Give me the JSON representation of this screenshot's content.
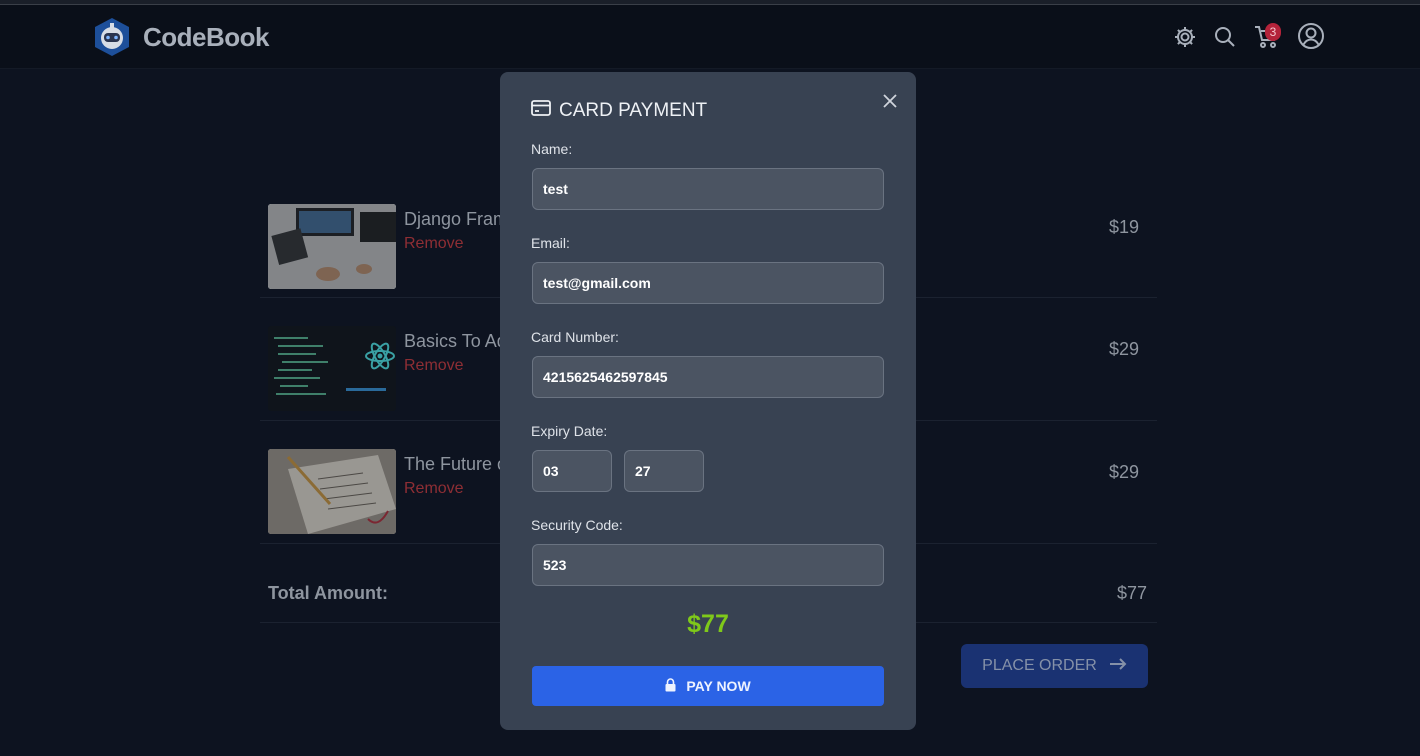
{
  "header": {
    "brand": "CodeBook",
    "cart_count": "3"
  },
  "cart": {
    "items": [
      {
        "title": "Django Fram",
        "remove_label": "Remove",
        "price": "$19"
      },
      {
        "title": "Basics To Ad",
        "remove_label": "Remove",
        "price": "$29"
      },
      {
        "title": "The Future o",
        "remove_label": "Remove",
        "price": "$29"
      }
    ],
    "total_label": "Total Amount:",
    "total_value": "$77",
    "place_order_label": "PLACE ORDER"
  },
  "modal": {
    "title": "CARD PAYMENT",
    "name_label": "Name:",
    "name_value": "test",
    "email_label": "Email:",
    "email_value": "test@gmail.com",
    "card_label": "Card Number:",
    "card_value": "4215625462597845",
    "expiry_label": "Expiry Date:",
    "expiry_month": "03",
    "expiry_year": "27",
    "security_label": "Security Code:",
    "security_value": "523",
    "amount": "$77",
    "pay_label": "PAY NOW"
  },
  "colors": {
    "accent": "#2b63e6",
    "amount": "#7fc91a",
    "remove": "#8e2e34",
    "badge": "#b4233a"
  }
}
